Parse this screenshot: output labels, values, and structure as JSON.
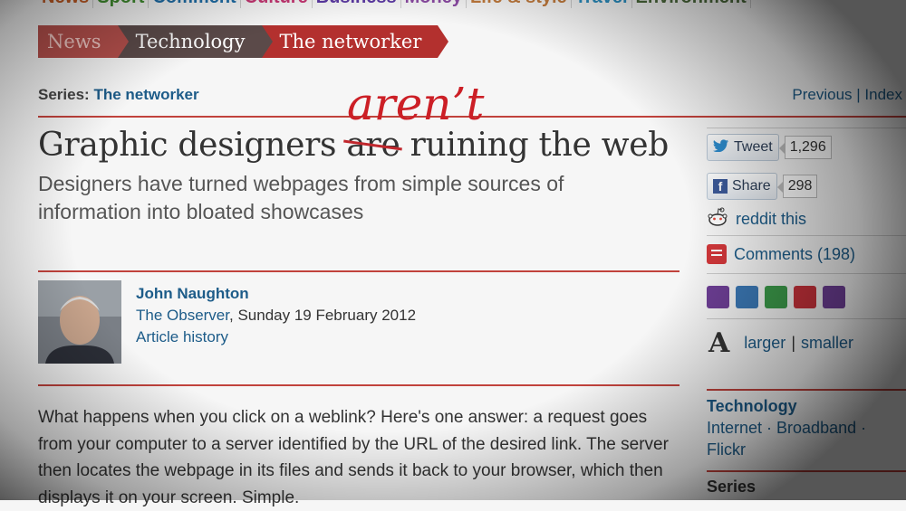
{
  "topnav": [
    {
      "label": "News",
      "color": "#c55c24"
    },
    {
      "label": "Sport",
      "color": "#3f8d2e"
    },
    {
      "label": "Comment",
      "color": "#1f6ea8"
    },
    {
      "label": "Culture",
      "color": "#c73673"
    },
    {
      "label": "Business",
      "color": "#5b38a3"
    },
    {
      "label": "Money",
      "color": "#8b4aa3"
    },
    {
      "label": "Life & style",
      "color": "#c17a3c"
    },
    {
      "label": "Travel",
      "color": "#2a8ec0"
    },
    {
      "label": "Environment",
      "color": "#4b6a3b"
    }
  ],
  "breadcrumb": [
    "News",
    "Technology",
    "The networker"
  ],
  "series": {
    "prefix": "Series:",
    "name": "The networker"
  },
  "prevnext": "Previous | Index",
  "headline": {
    "part1": "Graphic designers ",
    "struck": "are",
    "part2": " ruining the web",
    "correction": "aren’t"
  },
  "standfirst": "Designers have turned webpages from simple sources of information into bloated showcases",
  "byline": {
    "author": "John Naughton",
    "publication": "The Observer",
    "date": ", Sunday 19 February 2012",
    "history": "Article history"
  },
  "body": "What happens when you click on a weblink? Here's one answer: a request goes from your computer to a server identified by the URL of the desired link. The server then locates the webpage in its files and sends it back to your browser, which then displays it on your screen. Simple.",
  "sidebar": {
    "tweet_label": "Tweet",
    "tweet_count": "1,296",
    "share_label": "Share",
    "share_count": "298",
    "reddit": "reddit this",
    "comments": "Comments (198)",
    "larger": "larger",
    "sep": "|",
    "smaller": "smaller",
    "text_a": "A",
    "tech_heading": "Technology",
    "tech_links": "Internet · Broadband · Flickr",
    "series_heading": "Series"
  },
  "colors": {
    "accent": "#c1423c",
    "link": "#1d5c89",
    "correction": "#cc1f26"
  },
  "share_icons": [
    {
      "name": "print-icon",
      "color": "#6e3f96"
    },
    {
      "name": "email-icon",
      "color": "#3b78b5"
    },
    {
      "name": "share-icon",
      "color": "#3c9a4a"
    },
    {
      "name": "clip-icon",
      "color": "#c8323b"
    },
    {
      "name": "google-icon",
      "color": "#6e3f96"
    }
  ]
}
